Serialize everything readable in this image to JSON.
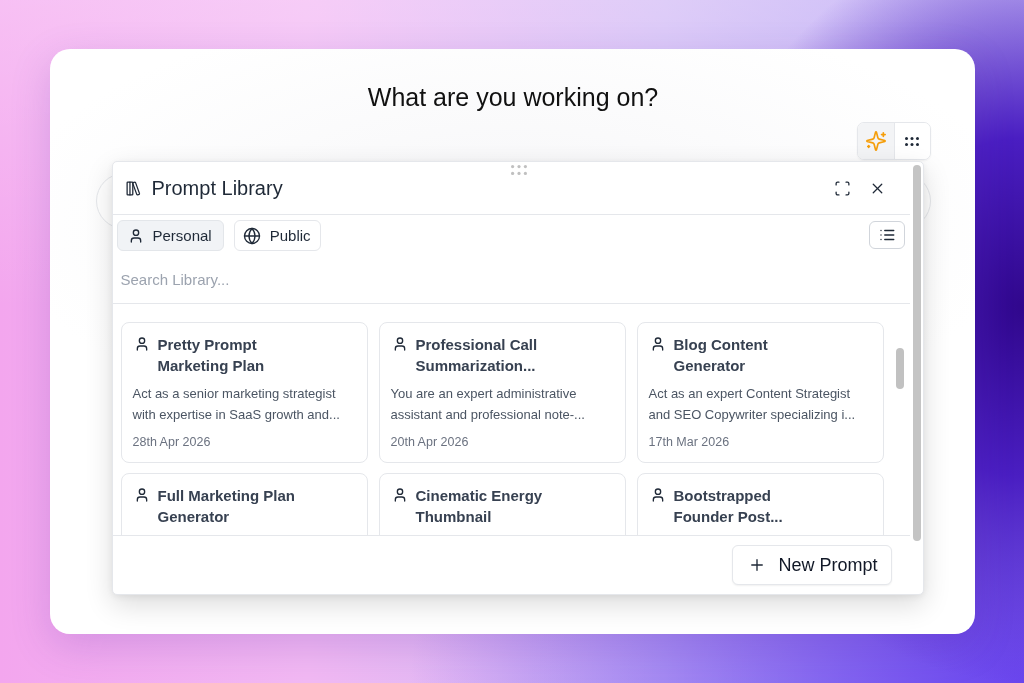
{
  "heading": "What are you working on?",
  "toolbar": [
    {
      "kind": "assist",
      "selected": true
    },
    {
      "kind": "apps",
      "selected": false
    }
  ],
  "panel": {
    "title": "Prompt Library",
    "tabs": [
      {
        "kind": "personal",
        "label": "Personal",
        "selected": true
      },
      {
        "kind": "public",
        "label": "Public",
        "selected": false
      }
    ],
    "search": {
      "placeholder": "Search Library..."
    },
    "prompts": [
      {
        "title": "Pretty Prompt Marketing Plan",
        "description": "Act as a senior marketing strategist with expertise in SaaS growth and...",
        "date": "28th Apr 2026"
      },
      {
        "title": "Professional Call Summarization...",
        "description": "You are an expert administrative assistant and professional note-...",
        "date": "20th Apr 2026"
      },
      {
        "title": "Blog Content Generator",
        "description": "Act as an expert Content Strategist and SEO Copywriter specializing i...",
        "date": "17th Mar 2026"
      },
      {
        "title": "Full Marketing Plan Generator"
      },
      {
        "title": "Cinematic Energy Thumbnail"
      },
      {
        "title": "Bootstrapped Founder Post..."
      }
    ],
    "new_button": "New Prompt"
  }
}
